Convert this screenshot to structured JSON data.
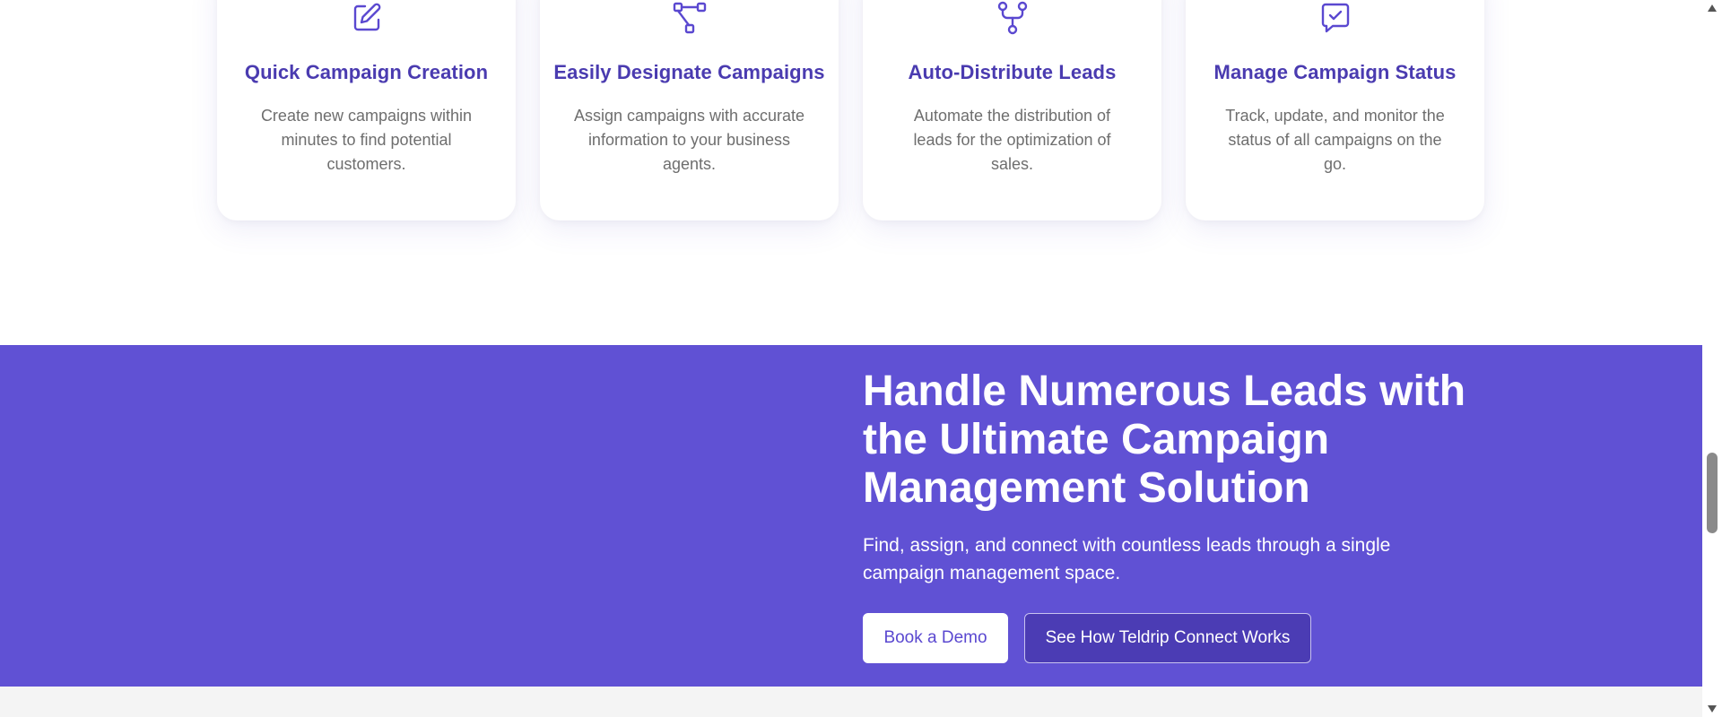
{
  "features": [
    {
      "icon": "edit-icon",
      "title": "Quick Campaign Creation",
      "description": "Create new campaigns within minutes to find potential customers."
    },
    {
      "icon": "hierarchy-icon",
      "title": "Easily Designate Campaigns",
      "description": "Assign campaigns with accurate information to your business agents."
    },
    {
      "icon": "fork-icon",
      "title": "Auto-Distribute Leads",
      "description": "Automate the distribution of leads for the optimization of sales."
    },
    {
      "icon": "message-check-icon",
      "title": "Manage Campaign Status",
      "description": "Track, update, and monitor the status of all campaigns on the go."
    }
  ],
  "cta": {
    "title": "Handle Numerous Leads with the Ultimate Campaign Management Solution",
    "subtitle": "Find, assign, and connect with countless leads through a single campaign management space.",
    "primary_button": "Book a Demo",
    "secondary_button": "See How Teldrip Connect Works"
  },
  "colors": {
    "accent": "#6051d4",
    "title": "#4a3bb0",
    "icon": "#5a48d0",
    "secondary_button": "#4b3cb4"
  },
  "scrollbar": {
    "up_icon": "arrow-up-icon",
    "down_icon": "arrow-down-icon"
  }
}
